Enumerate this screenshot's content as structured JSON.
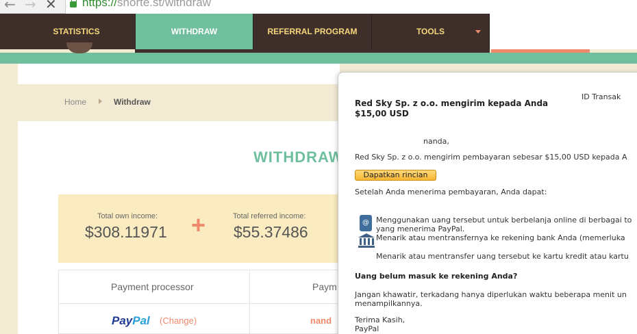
{
  "browser": {
    "url_scheme": "https://",
    "url_rest": "shorte.st/withdraw",
    "back_icon": "back-arrow-icon",
    "forward_icon": "forward-arrow-icon",
    "stop_icon": "close-icon"
  },
  "nav": {
    "items": [
      {
        "label": "STATISTICS"
      },
      {
        "label": "WITHDRAW"
      },
      {
        "label": "REFERRAL PROGRAM"
      },
      {
        "label": "TOOLS"
      }
    ]
  },
  "breadcrumb": {
    "home": "Home",
    "current": "Withdraw"
  },
  "withdraw": {
    "title": "WITHDRAW",
    "own_income_label": "Total own income:",
    "own_income_value": "$308.11971",
    "plus": "+",
    "referred_income_label": "Total referred income:",
    "referred_income_value": "$55.37486",
    "table": {
      "col1": "Payment processor",
      "col2": "Paym",
      "processor_logo_a": "Pay",
      "processor_logo_b": "Pal",
      "change": "(Change)",
      "partial_value": "nand"
    }
  },
  "popup": {
    "id_label": "ID Transak",
    "heading": "Red Sky Sp. z o.o. mengirim kepada Anda $15,00 USD",
    "greeting": "nanda,",
    "line1": "Red Sky Sp. z o.o. mengirim pembayaran sebesar $15,00 USD kepada A",
    "details_button": "Dapatkan rincian",
    "after_receive": "Setelah Anda menerima pembayaran, Anda dapat:",
    "option1_a": "Menggunakan uang tersebut untuk berbelanja online di berbagai to",
    "option1_b": "yang menerima PayPal.",
    "option2": "Menarik atau mentransfernya ke rekening bank Anda (memerluka",
    "option3": "Menarik atau mentransfer uang tersebut ke kartu kredit atau kartu",
    "not_arrived": "Uang belum masuk ke rekening Anda?",
    "dont_worry_a": "Jangan khawatir, terkadang hanya diperlukan waktu beberapa menit un",
    "dont_worry_b": "menampilkannya.",
    "thanks": "Terima Kasih,",
    "signature": "PayPal"
  },
  "colors": {
    "teal": "#6fbf9e",
    "dark_brown": "#3e2f2b",
    "nav_text": "#f6d67d",
    "salmon": "#f0886b",
    "cream": "#f2ead3",
    "income_box": "#faecc0"
  }
}
